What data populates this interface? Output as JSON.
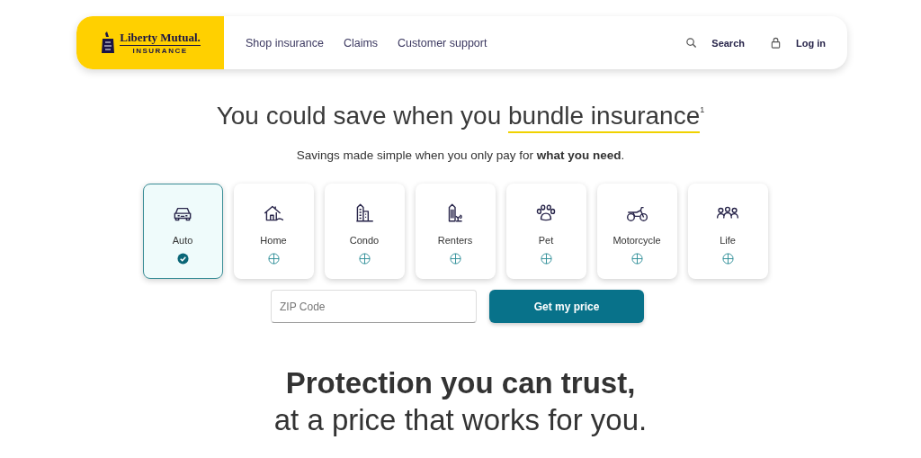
{
  "header": {
    "logo": {
      "name": "Liberty Mutual.",
      "tagline": "INSURANCE"
    },
    "nav": [
      "Shop insurance",
      "Claims",
      "Customer support"
    ],
    "actions": [
      {
        "kind": "search",
        "label": "Search"
      },
      {
        "kind": "lock",
        "label": "Log in"
      }
    ]
  },
  "hero": {
    "headline": "You could save when you",
    "highlight": "bundle insurance",
    "footnote": "1",
    "subtitle": "Savings made simple when you only pay for **what you need**."
  },
  "products": [
    {
      "kind": "car",
      "label": "Auto",
      "selected": true
    },
    {
      "kind": "house",
      "label": "Home",
      "selected": false
    },
    {
      "kind": "condo",
      "label": "Condo",
      "selected": false
    },
    {
      "kind": "renters",
      "label": "Renters",
      "selected": false
    },
    {
      "kind": "paw",
      "label": "Pet",
      "selected": false
    },
    {
      "kind": "motorcycle",
      "label": "Motorcycle",
      "selected": false
    },
    {
      "kind": "people",
      "label": "Life",
      "selected": false
    }
  ],
  "quote": {
    "placeholder": "ZIP Code",
    "button": "Get my price"
  },
  "promo": {
    "title": "Protection you can trust,",
    "subtitle": "at a price that works for you."
  }
}
